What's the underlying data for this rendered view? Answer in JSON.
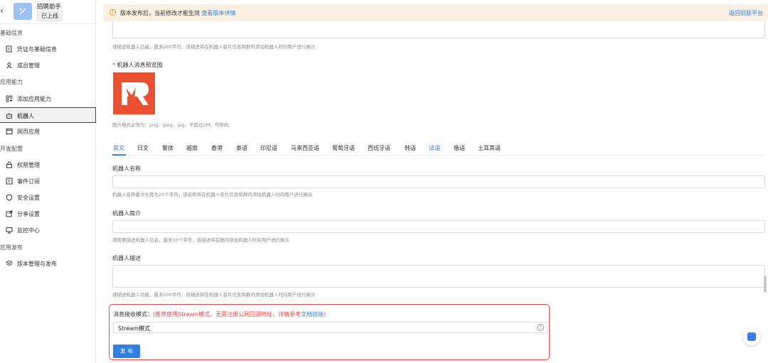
{
  "app": {
    "name": "招聘助手",
    "status": "已上线"
  },
  "sidebar": {
    "groups": [
      {
        "title": "基础信息",
        "items": [
          {
            "label": "凭证与基础信息",
            "icon": "credential-icon"
          },
          {
            "label": "成员管理",
            "icon": "user-icon"
          }
        ]
      },
      {
        "title": "应用能力",
        "items": [
          {
            "label": "添加应用能力",
            "icon": "grid-plus-icon"
          },
          {
            "label": "机器人",
            "icon": "robot-icon",
            "active": true
          },
          {
            "label": "网页应用",
            "icon": "webpage-icon"
          }
        ]
      },
      {
        "title": "开发配置",
        "items": [
          {
            "label": "权限管理",
            "icon": "key-icon"
          },
          {
            "label": "事件订阅",
            "icon": "subscribe-icon"
          },
          {
            "label": "安全设置",
            "icon": "shield-icon"
          },
          {
            "label": "分享设置",
            "icon": "share-icon"
          },
          {
            "label": "监控中心",
            "icon": "monitor-icon"
          }
        ]
      },
      {
        "title": "应用发布",
        "items": [
          {
            "label": "版本管理与发布",
            "icon": "layers-icon"
          }
        ]
      }
    ]
  },
  "banner": {
    "message": "版本发布后，当前修改才能生效",
    "link": "查看版本详情",
    "right_link": "返回旧版平台"
  },
  "form": {
    "top_hint": "请描述机器人功能，最多200字符，该描述将在机器人名片信息和群内添加机器人时向用户进行展示",
    "preview_label": "机器人消息预览图",
    "preview_hint": "图片格式必须为：png、jpeg、jpg，不超过2M，可修改。",
    "tabs": [
      "英文",
      "日文",
      "繁体",
      "越南",
      "香港",
      "泰语",
      "印尼语",
      "马来西亚语",
      "葡萄牙语",
      "西班牙语",
      "韩语",
      "法语",
      "俄语",
      "土耳其语"
    ],
    "tabs_active": "英文",
    "tabs_highlight": "法语",
    "name_label": "机器人名称",
    "name_hint": "机器人名称最大长度为20个字符，该名称将在机器人名片信息和群内添加机器人时向用户进行展示",
    "intro_label": "机器人简介",
    "intro_hint": "请简要描述机器人信息，最多10个字符，该描述将在群内添加机器人时向用户进行展示",
    "desc_label": "机器人描述",
    "desc_hint": "请描述机器人功能，最多200字符，该描述将在机器人名片信息和群内添加机器人时向用户进行展示"
  },
  "stream": {
    "title": "消息接收模式：",
    "note": "(推荐使用Stream模式，无需注册公网回调地址，详情参考",
    "link": "文档链接",
    "note_end": ")",
    "value": "Stream模式",
    "help": "?",
    "publish": "发 布"
  },
  "colors": {
    "accent": "#2f7fe3",
    "error": "#e5484d",
    "brand_logo": "#e9502f"
  }
}
